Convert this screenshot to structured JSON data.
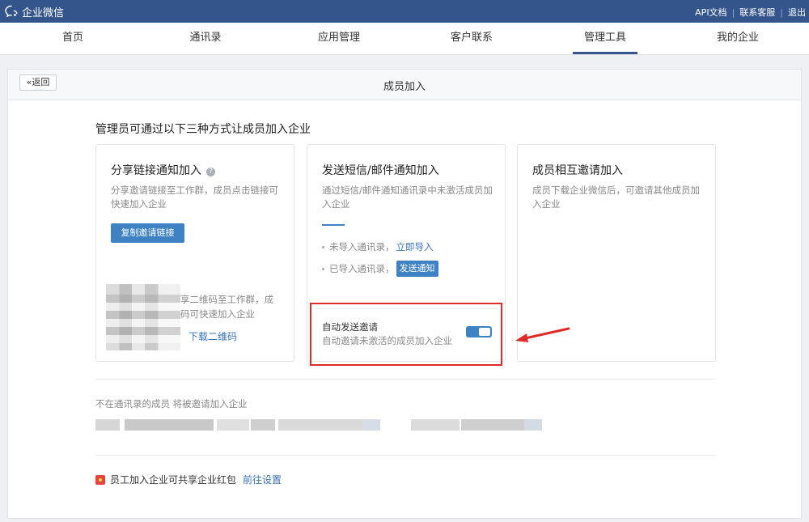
{
  "topbar": {
    "logo_text": "企业微信",
    "links": [
      "API文档",
      "联系客服",
      "退出"
    ]
  },
  "nav": {
    "items": [
      "首页",
      "通讯录",
      "应用管理",
      "客户联系",
      "管理工具",
      "我的企业"
    ],
    "active_index": 4
  },
  "panel": {
    "back_label": "«返回",
    "title": "成员加入"
  },
  "intro": "管理员可通过以下三种方式让成员加入企业",
  "cards": {
    "share": {
      "title": "分享链接通知加入",
      "help_icon": "?",
      "desc": "分享邀请链接至工作群，成员点击链接可快速加入企业",
      "copy_button": "复制邀请链接",
      "qr_text": "享二维码至工作群，成\n码可快速加入企业",
      "qr_link": "下载二维码"
    },
    "sms": {
      "title": "发送短信/邮件通知加入",
      "desc": "通过短信/邮件通知通讯录中未激活成员加入企业",
      "not_imported": "未导入通讯录，",
      "import_link": "立即导入",
      "imported": "已导入通讯录，",
      "notify_button": "发送通知",
      "auto_invite_title": "自动发送邀请",
      "auto_invite_desc": "自动邀请未激活的成员加入企业",
      "auto_invite_enabled": true
    },
    "mutual": {
      "title": "成员相互邀请加入",
      "desc": "成员下载企业微信后，可邀请其他成员加入企业"
    }
  },
  "members_label": "不在通讯录的成员 将被邀请加入企业",
  "redpack": {
    "text": "员工加入企业可共享企业红包",
    "link": "前往设置"
  },
  "colors": {
    "topbar": "#34558b",
    "accent": "#3e82c4",
    "link": "#3a72b4",
    "highlight": "#e02b2b"
  }
}
